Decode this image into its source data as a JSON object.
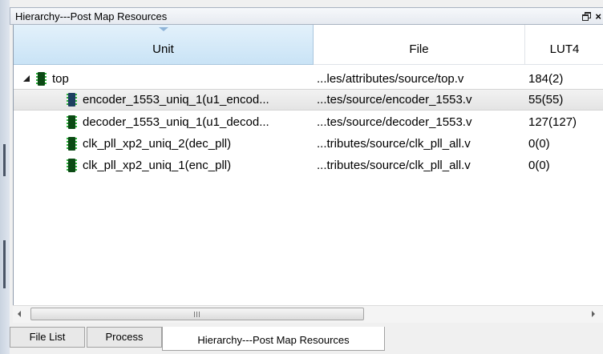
{
  "panel": {
    "title": "Hierarchy---Post Map Resources",
    "float_icon": "float-window-icon",
    "close_glyph": "×"
  },
  "columns": {
    "unit": "Unit",
    "file": "File",
    "lut4": "LUT4"
  },
  "rows": [
    {
      "unit": "top",
      "file": "...les/attributes/source/top.v",
      "lut4": "184(2)",
      "expanded": true,
      "selected": false
    },
    {
      "unit": "encoder_1553_uniq_1(u1_encod...",
      "file": "...tes/source/encoder_1553.v",
      "lut4": "55(55)",
      "selected": true
    },
    {
      "unit": "decoder_1553_uniq_1(u1_decod...",
      "file": "...tes/source/decoder_1553.v",
      "lut4": "127(127)",
      "selected": false
    },
    {
      "unit": "clk_pll_xp2_uniq_2(dec_pll)",
      "file": "...tributes/source/clk_pll_all.v",
      "lut4": "0(0)",
      "selected": false
    },
    {
      "unit": "clk_pll_xp2_uniq_1(enc_pll)",
      "file": "...tributes/source/clk_pll_all.v",
      "lut4": "0(0)",
      "selected": false
    }
  ],
  "scrollbar": {
    "grip_glyph": "III"
  },
  "tabs": [
    {
      "label": "File List",
      "active": false
    },
    {
      "label": "Process",
      "active": false
    },
    {
      "label": "Hierarchy---Post Map Resources",
      "active": true
    }
  ],
  "colors": {
    "header_selected": "#c9e3f6",
    "chip": "#0b4a14",
    "chip_selected": "#1d3f60"
  }
}
